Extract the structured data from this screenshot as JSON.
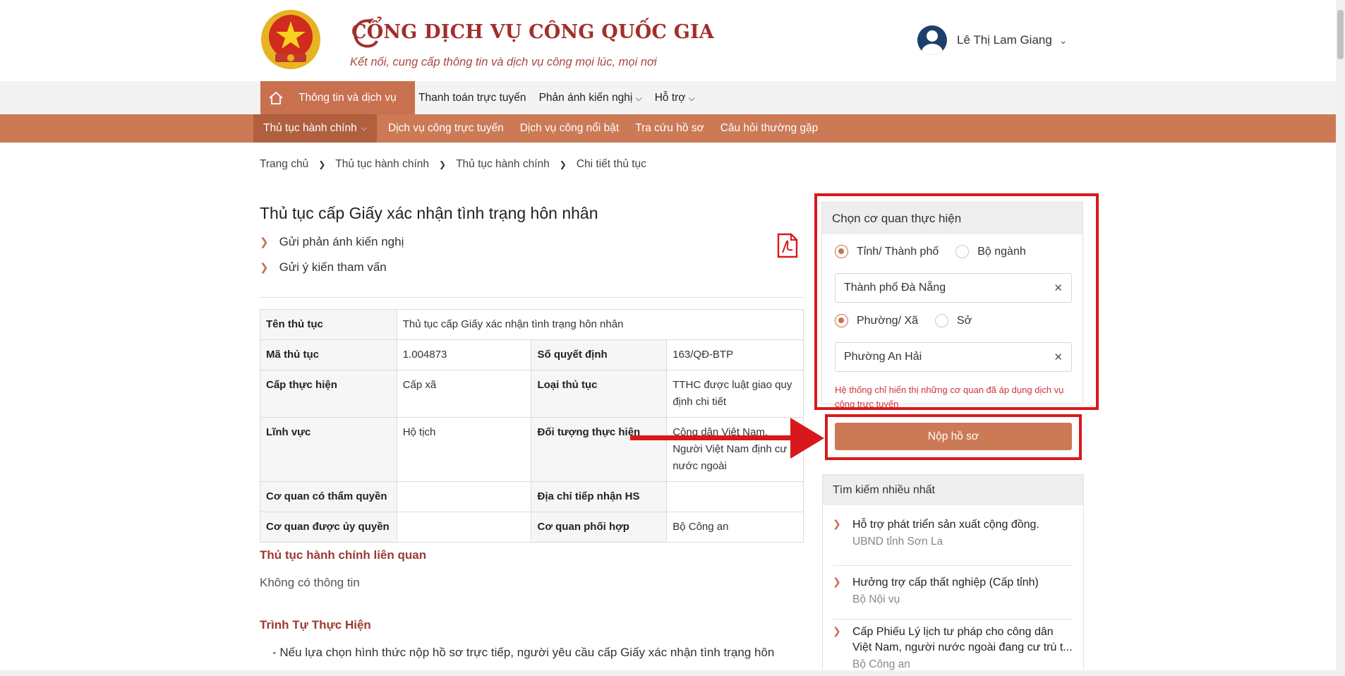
{
  "header": {
    "portal_title": "CỔNG DỊCH VỤ CÔNG QUỐC GIA",
    "portal_subtitle": "Kết nối, cung cấp thông tin và dịch vụ công mọi lúc, mọi nơi",
    "user_name": "Lê Thị Lam Giang"
  },
  "nav_primary": {
    "active": "Thông tin và dịch vụ",
    "items": [
      "Thanh toán trực tuyến",
      "Phản ánh kiến nghị",
      "Hỗ trợ"
    ]
  },
  "nav_secondary": {
    "active": "Thủ tục hành chính",
    "items": [
      "Dịch vụ công trực tuyến",
      "Dịch vụ công nổi bật",
      "Tra cứu hồ sơ",
      "Câu hỏi thường gặp"
    ]
  },
  "breadcrumb": [
    "Trang chủ",
    "Thủ tục hành chính",
    "Thủ tục hành chính",
    "Chi tiết thủ tục"
  ],
  "page": {
    "title": "Thủ tục cấp Giấy xác nhận tình trạng hôn nhân",
    "links": [
      "Gửi phản ánh kiến nghị",
      "Gửi ý kiến tham vấn"
    ]
  },
  "info_table": {
    "ten_thu_tuc_label": "Tên thủ tục",
    "ten_thu_tuc_value": "Thủ tục cấp Giấy xác nhận tình trạng hôn nhân",
    "ma_label": "Mã thủ tục",
    "ma_value": "1.004873",
    "so_qd_label": "Số quyết định",
    "so_qd_value": "163/QĐ-BTP",
    "cap_label": "Cấp thực hiện",
    "cap_value": "Cấp xã",
    "loai_label": "Loại thủ tục",
    "loai_value": "TTHC được luật giao quy định chi tiết",
    "linh_vuc_label": "Lĩnh vực",
    "linh_vuc_value": "Hộ tịch",
    "doi_tuong_label": "Đối tượng thực hiện",
    "doi_tuong_value": "Công dân Việt Nam, Người Việt Nam định cư ở nước ngoài",
    "co_quan_tq_label": "Cơ quan có thẩm quyền",
    "co_quan_tq_value": "",
    "dia_chi_label": "Địa chỉ tiếp nhận HS",
    "dia_chi_value": "",
    "co_quan_uq_label": "Cơ quan được ủy quyền",
    "co_quan_uq_value": "",
    "phoi_hop_label": "Cơ quan phối hợp",
    "phoi_hop_value": "Bộ Công an"
  },
  "sections": {
    "related_heading": "Thủ tục hành chính liên quan",
    "related_text": "Không có thông tin",
    "process_heading": "Trình Tự Thực Hiện",
    "process_text": "- Nếu lựa chọn hình thức nộp hồ sơ trực tiếp, người yêu cầu cấp Giấy xác nhận tình trạng hôn"
  },
  "agency_box": {
    "heading": "Chọn cơ quan thực hiện",
    "radio1_on": "Tỉnh/ Thành phố",
    "radio1_off": "Bộ ngành",
    "select1": "Thành phố Đà Nẵng",
    "radio2_on": "Phường/ Xã",
    "radio2_off": "Sở",
    "select2": "Phường An Hải",
    "note": "Hệ thống chỉ hiển thị những cơ quan đã áp dụng dịch vụ công trực tuyến",
    "submit": "Nộp hồ sơ"
  },
  "top_search": {
    "heading": "Tìm kiếm nhiều nhất",
    "items": [
      {
        "title": "Hỗ trợ phát triển sản xuất cộng đồng.",
        "org": "UBND tỉnh Sơn La"
      },
      {
        "title": "Hưởng trợ cấp thất nghiệp (Cấp tỉnh)",
        "org": "Bộ Nội vụ"
      },
      {
        "title": "Cấp Phiếu Lý lịch tư pháp cho công dân Việt Nam, người nước ngoài đang cư trú t...",
        "org": "Bộ Công an"
      }
    ]
  },
  "colors": {
    "brand": "#cc7a56",
    "brand_dark": "#b05f3f",
    "title_red": "#a22f2a",
    "highlight": "#d8191c"
  }
}
